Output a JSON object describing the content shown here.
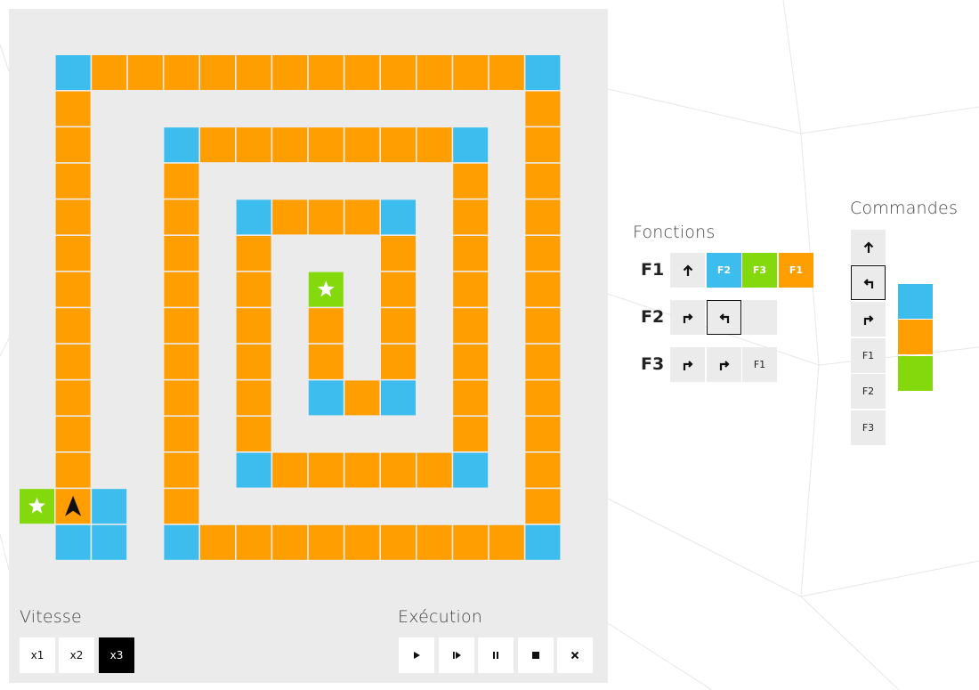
{
  "colors": {
    "orange": "#ff9e00",
    "blue": "#3dbdee",
    "green": "#84d90c",
    "panel": "#ebebeb",
    "active": "#000000"
  },
  "board": {
    "cells": [
      [
        0,
        1,
        "b"
      ],
      [
        0,
        2,
        "o"
      ],
      [
        0,
        3,
        "o"
      ],
      [
        0,
        4,
        "o"
      ],
      [
        0,
        5,
        "o"
      ],
      [
        0,
        6,
        "o"
      ],
      [
        0,
        7,
        "o"
      ],
      [
        0,
        8,
        "o"
      ],
      [
        0,
        9,
        "o"
      ],
      [
        0,
        10,
        "o"
      ],
      [
        0,
        11,
        "o"
      ],
      [
        0,
        12,
        "o"
      ],
      [
        0,
        13,
        "o"
      ],
      [
        0,
        14,
        "b"
      ],
      [
        1,
        1,
        "o"
      ],
      [
        1,
        14,
        "o"
      ],
      [
        2,
        1,
        "o"
      ],
      [
        2,
        4,
        "b"
      ],
      [
        2,
        5,
        "o"
      ],
      [
        2,
        6,
        "o"
      ],
      [
        2,
        7,
        "o"
      ],
      [
        2,
        8,
        "o"
      ],
      [
        2,
        9,
        "o"
      ],
      [
        2,
        10,
        "o"
      ],
      [
        2,
        11,
        "o"
      ],
      [
        2,
        12,
        "b"
      ],
      [
        2,
        14,
        "o"
      ],
      [
        3,
        1,
        "o"
      ],
      [
        3,
        4,
        "o"
      ],
      [
        3,
        12,
        "o"
      ],
      [
        3,
        14,
        "o"
      ],
      [
        4,
        1,
        "o"
      ],
      [
        4,
        4,
        "o"
      ],
      [
        4,
        6,
        "b"
      ],
      [
        4,
        7,
        "o"
      ],
      [
        4,
        8,
        "o"
      ],
      [
        4,
        9,
        "o"
      ],
      [
        4,
        10,
        "b"
      ],
      [
        4,
        12,
        "o"
      ],
      [
        4,
        14,
        "o"
      ],
      [
        5,
        1,
        "o"
      ],
      [
        5,
        4,
        "o"
      ],
      [
        5,
        6,
        "o"
      ],
      [
        5,
        10,
        "o"
      ],
      [
        5,
        12,
        "o"
      ],
      [
        5,
        14,
        "o"
      ],
      [
        6,
        1,
        "o"
      ],
      [
        6,
        4,
        "o"
      ],
      [
        6,
        6,
        "o"
      ],
      [
        6,
        8,
        "g"
      ],
      [
        6,
        10,
        "o"
      ],
      [
        6,
        12,
        "o"
      ],
      [
        6,
        14,
        "o"
      ],
      [
        7,
        1,
        "o"
      ],
      [
        7,
        4,
        "o"
      ],
      [
        7,
        6,
        "o"
      ],
      [
        7,
        8,
        "o"
      ],
      [
        7,
        10,
        "o"
      ],
      [
        7,
        12,
        "o"
      ],
      [
        7,
        14,
        "o"
      ],
      [
        8,
        1,
        "o"
      ],
      [
        8,
        4,
        "o"
      ],
      [
        8,
        6,
        "o"
      ],
      [
        8,
        8,
        "o"
      ],
      [
        8,
        10,
        "o"
      ],
      [
        8,
        12,
        "o"
      ],
      [
        8,
        14,
        "o"
      ],
      [
        9,
        1,
        "o"
      ],
      [
        9,
        4,
        "o"
      ],
      [
        9,
        6,
        "o"
      ],
      [
        9,
        8,
        "b"
      ],
      [
        9,
        9,
        "o"
      ],
      [
        9,
        10,
        "b"
      ],
      [
        9,
        12,
        "o"
      ],
      [
        9,
        14,
        "o"
      ],
      [
        10,
        1,
        "o"
      ],
      [
        10,
        4,
        "o"
      ],
      [
        10,
        6,
        "o"
      ],
      [
        10,
        12,
        "o"
      ],
      [
        10,
        14,
        "o"
      ],
      [
        11,
        1,
        "o"
      ],
      [
        11,
        4,
        "o"
      ],
      [
        11,
        6,
        "b"
      ],
      [
        11,
        7,
        "o"
      ],
      [
        11,
        8,
        "o"
      ],
      [
        11,
        9,
        "o"
      ],
      [
        11,
        10,
        "o"
      ],
      [
        11,
        11,
        "o"
      ],
      [
        11,
        12,
        "b"
      ],
      [
        11,
        14,
        "o"
      ],
      [
        12,
        0,
        "g"
      ],
      [
        12,
        1,
        "o"
      ],
      [
        12,
        2,
        "b"
      ],
      [
        12,
        4,
        "o"
      ],
      [
        12,
        14,
        "o"
      ],
      [
        13,
        1,
        "b"
      ],
      [
        13,
        2,
        "b"
      ],
      [
        13,
        4,
        "b"
      ],
      [
        13,
        5,
        "o"
      ],
      [
        13,
        6,
        "o"
      ],
      [
        13,
        7,
        "o"
      ],
      [
        13,
        8,
        "o"
      ],
      [
        13,
        9,
        "o"
      ],
      [
        13,
        10,
        "o"
      ],
      [
        13,
        11,
        "o"
      ],
      [
        13,
        12,
        "o"
      ],
      [
        13,
        13,
        "o"
      ],
      [
        13,
        14,
        "b"
      ]
    ],
    "stars": [
      [
        12,
        0
      ],
      [
        6,
        8
      ]
    ],
    "star_icon": "star-icon",
    "robot": {
      "row": 12,
      "col": 1,
      "direction": "up",
      "icon": "robot-arrow-icon"
    }
  },
  "speed": {
    "title": "Vitesse",
    "options": [
      "x1",
      "x2",
      "x3"
    ],
    "selected": "x3"
  },
  "execution": {
    "title": "Exécution",
    "buttons": [
      {
        "name": "play-button",
        "icon": "play-icon"
      },
      {
        "name": "step-button",
        "icon": "step-icon"
      },
      {
        "name": "pause-button",
        "icon": "pause-icon"
      },
      {
        "name": "stop-button",
        "icon": "stop-icon"
      },
      {
        "name": "clear-button",
        "icon": "close-icon"
      }
    ]
  },
  "functions": {
    "title": "Fonctions",
    "rows": [
      {
        "label": "F1",
        "slots": [
          {
            "icon": "arrow-up-icon",
            "text": "",
            "color": ""
          },
          {
            "icon": "",
            "text": "F2",
            "color": "b"
          },
          {
            "icon": "",
            "text": "F3",
            "color": "g"
          },
          {
            "icon": "",
            "text": "F1",
            "color": "o"
          }
        ]
      },
      {
        "label": "F2",
        "slots": [
          {
            "icon": "turn-right-icon",
            "text": "",
            "color": ""
          },
          {
            "icon": "turn-left-icon",
            "text": "",
            "color": "",
            "selected": true
          },
          {
            "icon": "",
            "text": "",
            "color": ""
          }
        ]
      },
      {
        "label": "F3",
        "slots": [
          {
            "icon": "turn-right-icon",
            "text": "",
            "color": ""
          },
          {
            "icon": "turn-right-icon",
            "text": "",
            "color": ""
          },
          {
            "icon": "",
            "text": "F1",
            "color": ""
          }
        ]
      }
    ]
  },
  "commands": {
    "title": "Commandes",
    "items": [
      {
        "icon": "arrow-up-icon",
        "text": ""
      },
      {
        "icon": "turn-left-icon",
        "text": "",
        "selected": true
      },
      {
        "icon": "turn-right-icon",
        "text": ""
      },
      {
        "icon": "",
        "text": "F1"
      },
      {
        "icon": "",
        "text": "F2"
      },
      {
        "icon": "",
        "text": "F3"
      }
    ],
    "swatches": [
      "b",
      "o",
      "g"
    ]
  }
}
